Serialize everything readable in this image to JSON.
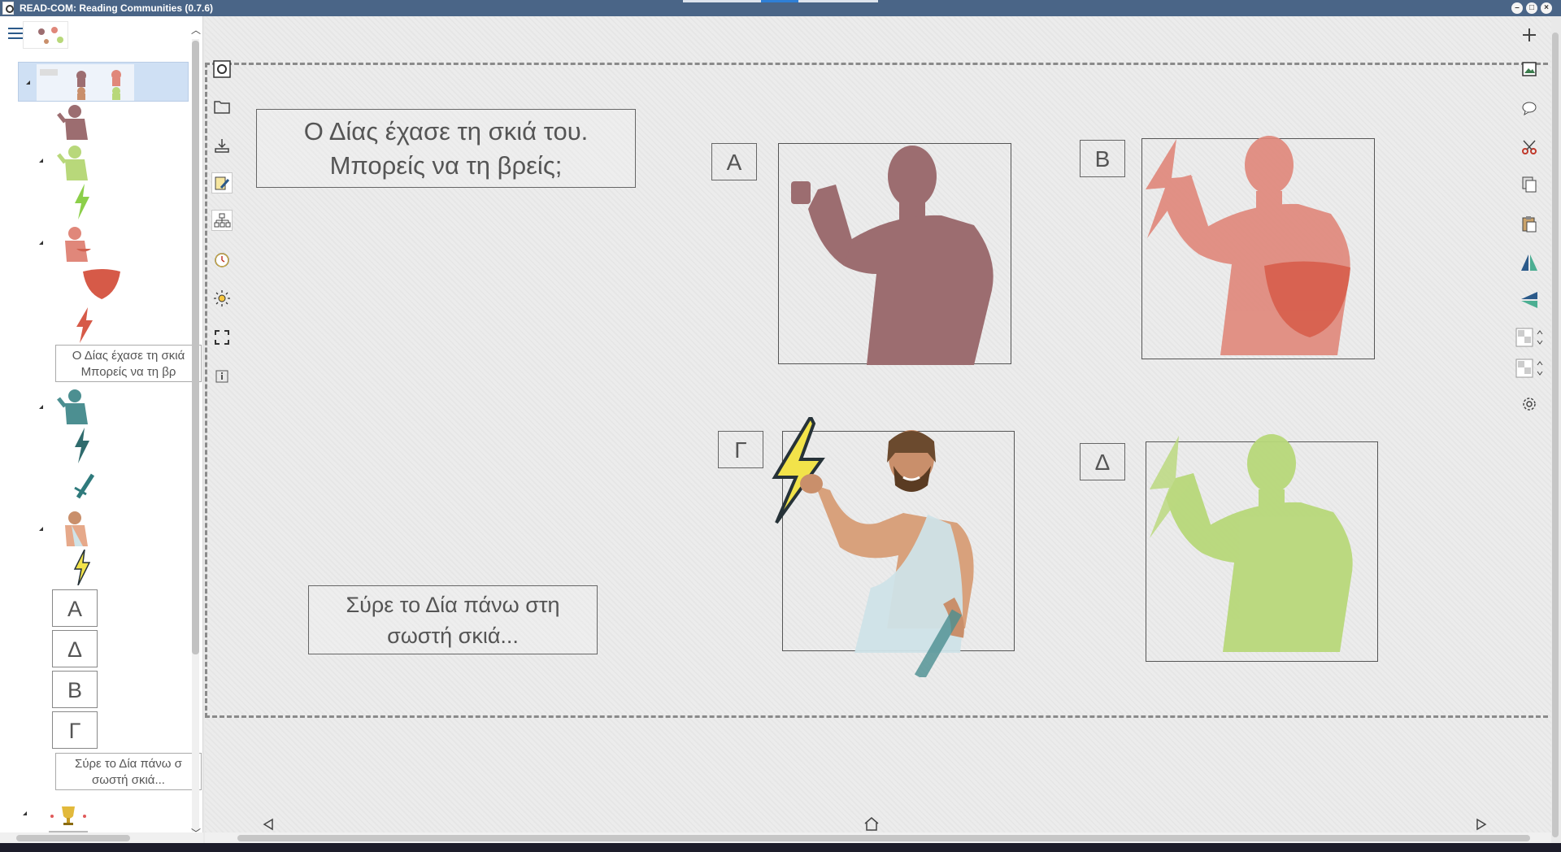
{
  "window": {
    "title": "READ-COM: Reading Communities (0.7.6)",
    "controls": [
      "minimize",
      "maximize",
      "close"
    ]
  },
  "sidebar": {
    "letters": [
      "Α",
      "Δ",
      "Β",
      "Γ"
    ],
    "text_items": [
      {
        "line1": "Ο Δίας έχασε τη σκιά",
        "line2": "Μπορείς να τη βρ"
      },
      {
        "line1": "Σύρε το Δία πάνω σ",
        "line2": "σωστή σκιά..."
      }
    ]
  },
  "canvas": {
    "question": {
      "line1": "Ο Δίας έχασε τη σκιά του.",
      "line2": "Μπορείς να τη βρείς;"
    },
    "instruction": {
      "line1": "Σύρε το Δία πάνω στη",
      "line2": "σωστή σκιά..."
    },
    "options": [
      {
        "label": "Α",
        "color": "#9c6d70"
      },
      {
        "label": "Β",
        "color": "#e0877a"
      },
      {
        "label": "Γ",
        "color": "#c98f6b"
      },
      {
        "label": "Δ",
        "color": "#b8d87a"
      }
    ]
  },
  "left_tools": [
    "logo-icon",
    "open-folder-icon",
    "download-icon",
    "edit-icon",
    "hierarchy-icon",
    "timer-icon",
    "brightness-icon",
    "fullscreen-icon",
    "info-icon"
  ],
  "right_tools": [
    "add-icon",
    "image-icon",
    "comment-icon",
    "cut-icon",
    "copy-icon",
    "paste-icon",
    "flip-horizontal-icon",
    "flip-vertical-icon",
    "opacity-icon",
    "transparency-icon",
    "settings-icon"
  ],
  "colors": {
    "titlebar": "#4a6587",
    "accent": "#2b5a8a"
  }
}
